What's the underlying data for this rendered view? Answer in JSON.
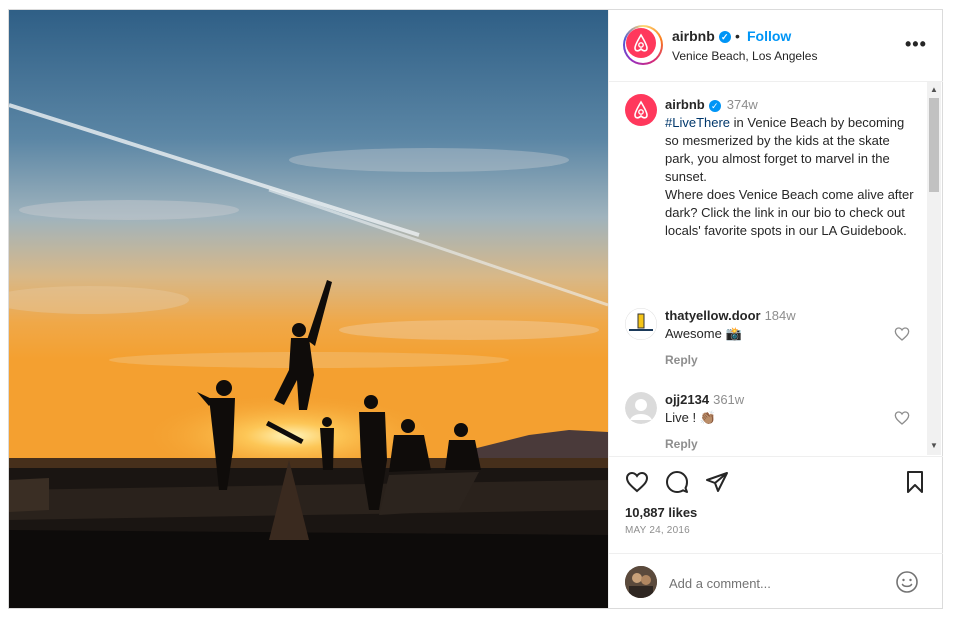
{
  "post": {
    "username": "airbnb",
    "verified_mark": "✓",
    "separator": "•",
    "follow_label": "Follow",
    "location": "Venice Beach, Los Angeles",
    "more_label": "•••"
  },
  "caption": {
    "username": "airbnb",
    "time": "374w",
    "hashtag": "#LiveThere",
    "text_1": " in Venice Beach by becoming so mesmerized by the kids at the skate park, you almost forget to marvel in the sunset.",
    "text_2": "Where does Venice Beach come alive after dark? Click the link in our bio to check out locals' favorite spots in our LA Guidebook."
  },
  "comments": [
    {
      "username": "thatyellow.door",
      "time": "184w",
      "text": "Awesome 📸",
      "reply_label": "Reply"
    },
    {
      "username": "ojj2134",
      "time": "361w",
      "text": "Live ! 👏🏽",
      "reply_label": "Reply"
    }
  ],
  "stats": {
    "likes": "10,887 likes",
    "date": "MAY 24, 2016"
  },
  "add_comment": {
    "placeholder": "Add a comment..."
  },
  "colors": {
    "brand": "#ff385c",
    "link": "#0095f6",
    "hashtag": "#00376b",
    "muted": "#8e8e8e"
  },
  "icons": {
    "like": "heart-icon",
    "comment": "comment-icon",
    "share": "share-icon",
    "save": "bookmark-icon",
    "emoji": "emoji-icon",
    "more": "more-icon"
  }
}
